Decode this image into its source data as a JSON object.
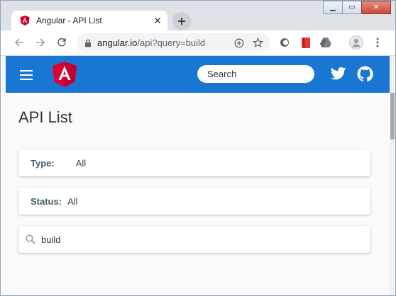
{
  "browser": {
    "tab": {
      "title": "Angular - API List"
    },
    "address": {
      "host": "angular.io",
      "path": "/api?query=build"
    }
  },
  "site": {
    "search_placeholder": "Search",
    "brand_color": "#1976d2"
  },
  "page": {
    "title": "API List",
    "filters": [
      {
        "label": "Type:",
        "value": "All"
      },
      {
        "label": "Status:",
        "value": "All"
      }
    ],
    "query": "build"
  },
  "icons": [
    "angular-favicon-icon",
    "close-icon",
    "plus-icon",
    "back-icon",
    "forward-icon",
    "reload-icon",
    "lock-icon",
    "add-icon",
    "star-icon",
    "extension-icon",
    "bookmark-icon",
    "drive-icon",
    "profile-icon",
    "menu-icon",
    "hamburger-icon",
    "angular-logo-icon",
    "twitter-icon",
    "github-icon",
    "search-icon"
  ]
}
